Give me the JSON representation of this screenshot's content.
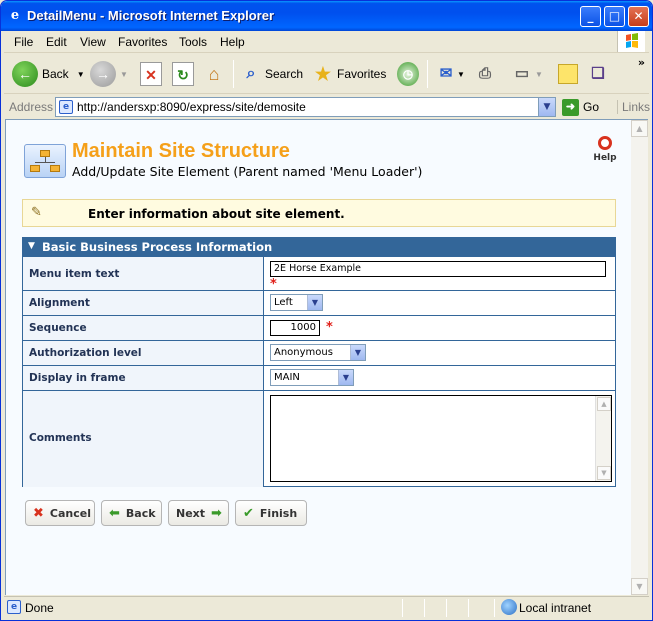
{
  "window": {
    "title": "DetailMenu - Microsoft Internet Explorer",
    "min_glyph": "_",
    "max_glyph": "□",
    "close_glyph": "✕"
  },
  "menubar": {
    "items": [
      "File",
      "Edit",
      "View",
      "Favorites",
      "Tools",
      "Help"
    ]
  },
  "toolbar": {
    "back_label": "Back",
    "search_label": "Search",
    "favorites_label": "Favorites",
    "more_glyph": "»"
  },
  "address": {
    "label": "Address",
    "url": "http://andersxp:8090/express/site/demosite",
    "go_label": "Go",
    "links_label": "Links"
  },
  "page": {
    "title": "Maintain Site Structure",
    "subtitle": "Add/Update Site Element (Parent named 'Menu Loader')",
    "help_label": "Help",
    "info_text": "Enter information about site element.",
    "section_title": "Basic Business Process Information",
    "required_mark": "*",
    "fields": {
      "menu_item_text": {
        "label": "Menu item text",
        "value": "2E Horse Example"
      },
      "alignment": {
        "label": "Alignment",
        "value": "Left"
      },
      "sequence": {
        "label": "Sequence",
        "value": "1000"
      },
      "authorization_level": {
        "label": "Authorization level",
        "value": "Anonymous"
      },
      "display_in_frame": {
        "label": "Display in frame",
        "value": "MAIN"
      },
      "comments": {
        "label": "Comments",
        "value": ""
      }
    },
    "buttons": {
      "cancel": "Cancel",
      "back": "Back",
      "next": "Next",
      "finish": "Finish"
    }
  },
  "statusbar": {
    "text": "Done",
    "zone": "Local intranet"
  },
  "colors": {
    "title_orange": "#f5a01a",
    "section_blue": "#336699",
    "required_red": "#e0201a"
  }
}
